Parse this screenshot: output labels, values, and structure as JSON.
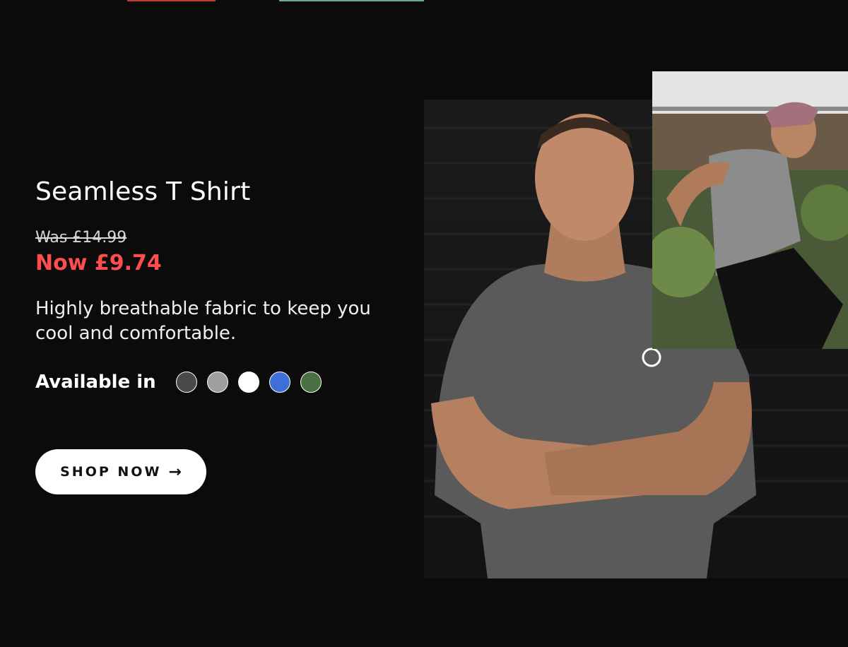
{
  "product": {
    "title": "Seamless T Shirt",
    "was_price": "Was £14.99",
    "now_price": "Now £9.74",
    "description": "Highly breathable fabric to keep you cool and comfortable.",
    "available_label": "Available in",
    "swatches": [
      {
        "name": "charcoal",
        "color": "#4a4a4a"
      },
      {
        "name": "grey",
        "color": "#9e9e9e"
      },
      {
        "name": "white",
        "color": "#ffffff"
      },
      {
        "name": "blue",
        "color": "#3d6fd6"
      },
      {
        "name": "green",
        "color": "#4c7044"
      }
    ]
  },
  "cta": {
    "label": "SHOP NOW",
    "arrow": "→"
  },
  "colors": {
    "sale": "#ff4d4d",
    "background": "#0b0b0b"
  },
  "images": {
    "main": "man-arms-crossed-photo",
    "side": "man-running-photo"
  }
}
